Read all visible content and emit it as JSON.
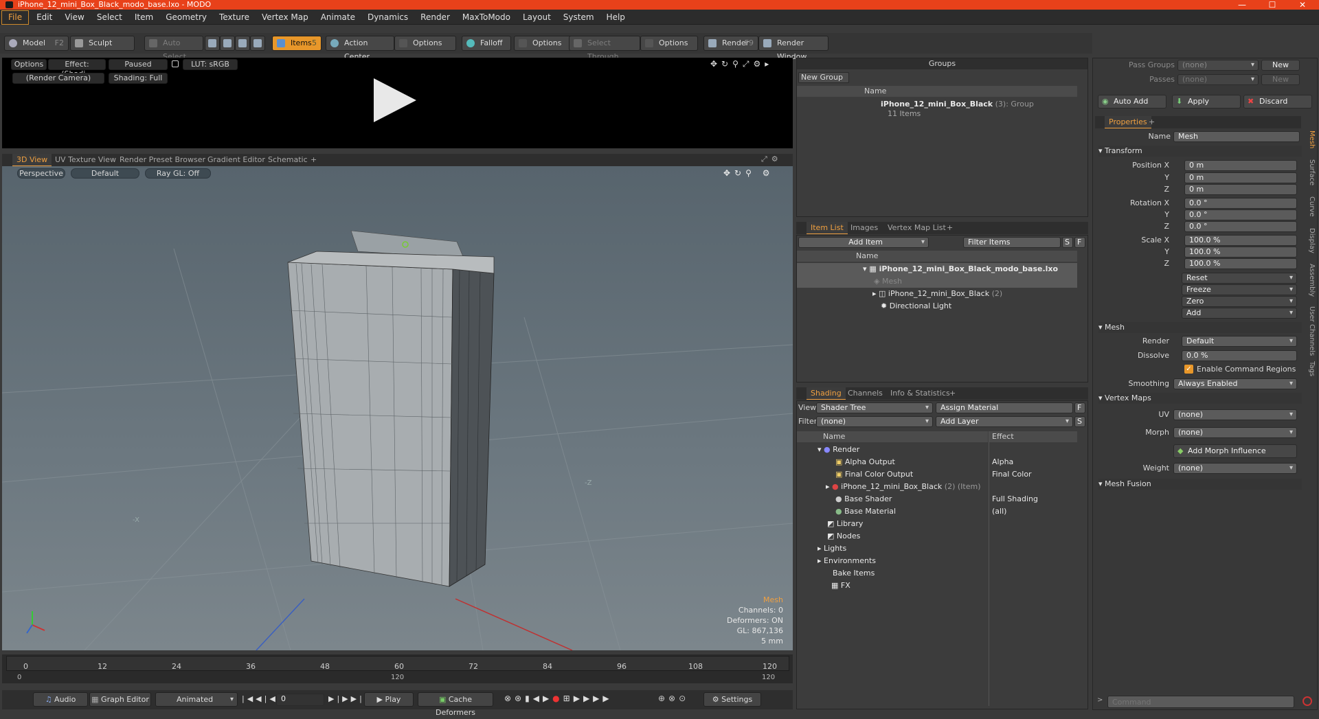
{
  "window": {
    "title": "iPhone_12_mini_Box_Black_modo_base.lxo - MODO"
  },
  "menu": [
    "File",
    "Edit",
    "View",
    "Select",
    "Item",
    "Geometry",
    "Texture",
    "Vertex Map",
    "Animate",
    "Dynamics",
    "Render",
    "MaxToModo",
    "Layout",
    "System",
    "Help"
  ],
  "toolbar": {
    "model": "Model",
    "model_key": "F2",
    "sculpt": "Sculpt",
    "auto_select": "Auto Select",
    "items": "Items",
    "items_key": "5",
    "action_center": "Action Center",
    "options1": "Options",
    "falloff": "Falloff",
    "options2": "Options",
    "select_through": "Select Through",
    "options3": "Options",
    "render": "Render",
    "render_key": "F9",
    "render_window": "Render Window"
  },
  "preview": {
    "options": "Options",
    "effect": "Effect: (Shadi...",
    "paused": "Paused",
    "lut": "LUT: sRGB",
    "camera": "(Render Camera)",
    "shading": "Shading: Full"
  },
  "viewport_tabs": [
    "3D View",
    "UV Texture View",
    "Render Preset Browser",
    "Gradient Editor",
    "Schematic",
    "+"
  ],
  "viewport": {
    "perspective": "Perspective",
    "default": "Default",
    "raygl": "Ray GL: Off",
    "axis_x": "-X",
    "axis_z": "-Z",
    "hud": {
      "title": "Mesh",
      "channels": "Channels: 0",
      "deformers": "Deformers: ON",
      "gl": "GL: 867,136",
      "size": "5 mm"
    }
  },
  "timeline": {
    "ticks": [
      "0",
      "12",
      "24",
      "36",
      "48",
      "60",
      "72",
      "84",
      "96",
      "108",
      "120"
    ],
    "sub_start": "0",
    "sub_mid": "120",
    "sub_end": "120"
  },
  "bottombar": {
    "audio": "Audio",
    "graph_editor": "Graph Editor",
    "animated": "Animated",
    "frame": "0",
    "play": "Play",
    "cache": "Cache Deformers",
    "settings": "Settings"
  },
  "groups": {
    "title": "Groups",
    "new_group": "New Group",
    "col_name": "Name",
    "item_name": "iPhone_12_mini_Box_Black",
    "item_count": "(3)",
    "item_type": ": Group",
    "item_sub": "11 Items"
  },
  "itemlist": {
    "tabs": [
      "Item List",
      "Images",
      "Vertex Map List",
      "+"
    ],
    "add_item": "Add Item",
    "filter": "Filter Items",
    "s": "S",
    "f": "F",
    "col_name": "Name",
    "rows": [
      {
        "name": "iPhone_12_mini_Box_Black_modo_base.lxo",
        "extra": ""
      },
      {
        "name": "Mesh",
        "extra": ""
      },
      {
        "name": "iPhone_12_mini_Box_Black",
        "extra": "(2)"
      },
      {
        "name": "Directional Light",
        "extra": ""
      }
    ]
  },
  "shading": {
    "tabs": [
      "Shading",
      "Channels",
      "Info & Statistics",
      "+"
    ],
    "view_label": "View",
    "view_value": "Shader Tree",
    "assign": "Assign Material",
    "f": "F",
    "filter_label": "Filter",
    "filter_value": "(none)",
    "add_layer": "Add Layer",
    "s": "S",
    "col_name": "Name",
    "col_effect": "Effect",
    "rows": [
      {
        "name": "Render",
        "effect": ""
      },
      {
        "name": "Alpha Output",
        "effect": "Alpha"
      },
      {
        "name": "Final Color Output",
        "effect": "Final Color"
      },
      {
        "name": "iPhone_12_mini_Box_Black",
        "extra": "(2) (Item)",
        "effect": ""
      },
      {
        "name": "Base Shader",
        "effect": "Full Shading"
      },
      {
        "name": "Base Material",
        "effect": "(all)"
      },
      {
        "name": "Library",
        "effect": ""
      },
      {
        "name": "Nodes",
        "effect": ""
      },
      {
        "name": "Lights",
        "effect": ""
      },
      {
        "name": "Environments",
        "effect": ""
      },
      {
        "name": "Bake Items",
        "effect": ""
      },
      {
        "name": "FX",
        "effect": ""
      }
    ]
  },
  "pass": {
    "pass_groups": "Pass Groups",
    "pg_value": "(none)",
    "new": "New",
    "passes": "Passes",
    "p_value": "(none)",
    "new2": "New"
  },
  "actions": {
    "auto_add": "Auto Add",
    "apply": "Apply",
    "discard": "Discard"
  },
  "properties": {
    "tab": "Properties",
    "plus": "+",
    "name_label": "Name",
    "name_value": "Mesh",
    "transform": "Transform",
    "pos_label": "Position X",
    "pos": [
      "0 m",
      "0 m",
      "0 m"
    ],
    "rot_label": "Rotation X",
    "rot": [
      "0.0 °",
      "0.0 °",
      "0.0 °"
    ],
    "scale_label": "Scale X",
    "scale": [
      "100.0 %",
      "100.0 %",
      "100.0 %"
    ],
    "y": "Y",
    "z": "Z",
    "reset": "Reset",
    "freeze": "Freeze",
    "zero": "Zero",
    "add": "Add",
    "mesh": "Mesh",
    "render_label": "Render",
    "render_value": "Default",
    "dissolve_label": "Dissolve",
    "dissolve_value": "0.0 %",
    "enable_cmd": "Enable Command Regions",
    "smoothing_label": "Smoothing",
    "smoothing_value": "Always Enabled",
    "vertex_maps": "Vertex Maps",
    "uv_label": "UV",
    "uv_value": "(none)",
    "morph_label": "Morph",
    "morph_value": "(none)",
    "add_morph": "Add Morph Influence",
    "weight_label": "Weight",
    "weight_value": "(none)",
    "mesh_fusion": "Mesh Fusion"
  },
  "side_tabs": [
    "Mesh",
    "Surface",
    "Curve",
    "Display",
    "Assembly",
    "User Channels",
    "Tags"
  ],
  "command": {
    "placeholder": "Command"
  }
}
